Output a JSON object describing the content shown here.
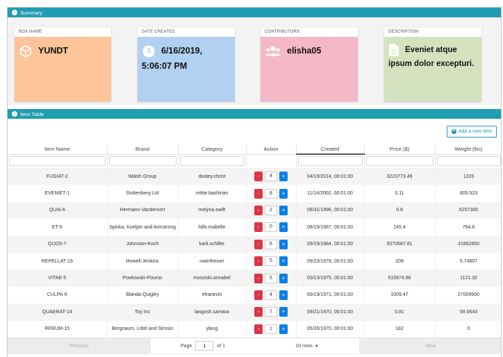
{
  "colors": {
    "accent": "#1f9db1",
    "minus": "#dc3545",
    "plus": "#0b7fe8",
    "box_card": "#fdc49a",
    "date_card": "#b2d0f0",
    "contrib_card": "#f4b8c7",
    "desc_card": "#d4e2bf"
  },
  "summary": {
    "title": "Summary",
    "cards": [
      {
        "label": "BOX NAME",
        "value": "YUNDT",
        "icon": "cube-icon"
      },
      {
        "label": "DATE CREATED",
        "value": "6/16/2019, 5:06:07 PM",
        "icon": "clock-icon"
      },
      {
        "label": "CONTRIBUTORS",
        "value": "elisha05",
        "icon": "users-icon"
      },
      {
        "label": "DESCRIPTION",
        "value": "Eveniet atque ipsum dolor excepturi.",
        "icon": "file-icon"
      }
    ]
  },
  "item_table": {
    "title": "Item Table",
    "add_label": "Add a new item",
    "columns": [
      "Item Name",
      "Brand",
      "Category",
      "Action",
      "Created",
      "Price ($)",
      "Weight (lbs)"
    ],
    "rows": [
      {
        "name": "FUGIAT-2",
        "brand": "Walsh Group",
        "category": "dooley.christ",
        "qty": "4",
        "created": "04/19/2014, 00:01:00",
        "price": "3223773.49",
        "weight": "1226"
      },
      {
        "name": "EVENIET-1",
        "brand": "Stoltenberg Ltd",
        "category": "mittie.bashirian",
        "qty": "8",
        "created": "11/14/2002, 00:01:00",
        "price": "0.11",
        "weight": "605.523"
      },
      {
        "name": "QUIA-6",
        "brand": "Hermann-Vandervort",
        "category": "melyna.swift",
        "qty": "2",
        "created": "06/31/1996, 00:01:00",
        "price": "0.8",
        "weight": "6257300"
      },
      {
        "name": "ET-6",
        "brand": "Spinka, Koelpin and Armstrong",
        "category": "hills.mabelle",
        "qty": "0",
        "created": "08/19/1987, 00:01:00",
        "price": "145.4",
        "weight": "764.8"
      },
      {
        "name": "QUOS-7",
        "brand": "Johnston-Koch",
        "category": "karli.schiller",
        "qty": "6",
        "created": "09/19/1984, 00:01:00",
        "price": "5070687.81",
        "weight": "31862800"
      },
      {
        "name": "REPELLAT-19",
        "brand": "Howell-Jenkins",
        "category": "nwintheiser",
        "qty": "5",
        "created": "09/23/1978, 00:01:00",
        "price": "208",
        "weight": "5.74807"
      },
      {
        "name": "VITAE-5",
        "brand": "Powlowski-Pouros",
        "category": "mosciski.annabel",
        "qty": "5",
        "created": "00/13/1975, 00:01:00",
        "price": "515674.86",
        "weight": "1121.32"
      },
      {
        "name": "CULPA-6",
        "brand": "Blanda-Quigley",
        "category": "efranecki",
        "qty": "4",
        "created": "00/19/1971, 00:01:00",
        "price": "1009.47",
        "weight": "27009500"
      },
      {
        "name": "QUAERAT-14",
        "brand": "Toy Inc",
        "category": "langosh.samara",
        "qty": "1",
        "created": "09/21/1970, 00:01:00",
        "price": "0.81",
        "weight": "59.0643"
      },
      {
        "name": "RERUM-15",
        "brand": "Bergnaum, Littel and Strosin",
        "category": "ylang",
        "qty": "1",
        "created": "05/26/1970, 00:01:00",
        "price": "182",
        "weight": "0"
      }
    ],
    "pagination": {
      "previous": "Previous",
      "next": "Next",
      "page_label": "Page",
      "page_value": "1",
      "of_label": "of 1",
      "rows_label": "10 rows"
    }
  }
}
